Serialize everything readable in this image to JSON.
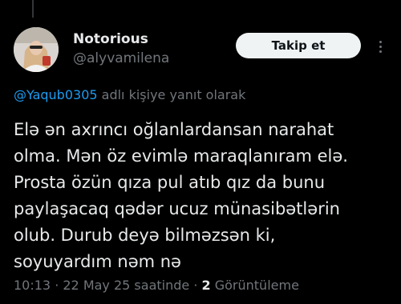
{
  "author": {
    "display_name": "Notorious",
    "handle": "@alyvamilena"
  },
  "follow_button": {
    "label": "Takip et"
  },
  "more_icon": "more-dots-vertical-icon",
  "reply_context": {
    "mention": "@Yaqub0305",
    "suffix": " adlı kişiye yanıt olarak"
  },
  "tweet": {
    "lines": [
      "Elə ən axrıncı oğlanlardansan narahat",
      "olma. Mən öz evimlə maraqlanıram elə.",
      "Prosta özün qıza pul atıb qız da bunu",
      "paylaşacaq qədər ucuz münasibətlərin",
      "olub. Durub deyə bilməzsən ki,",
      "soyuyardım nəm nə"
    ]
  },
  "meta": {
    "time": "10:13",
    "sep1": " · ",
    "date": "22 May 25 saatinde",
    "sep2": " · ",
    "views_count": "2",
    "views_label": " Görüntüleme"
  },
  "colors": {
    "background": "#000000",
    "text": "#e7e9ea",
    "secondary": "#71767b",
    "link": "#1d9bf0",
    "button_bg": "#eff3f4"
  }
}
